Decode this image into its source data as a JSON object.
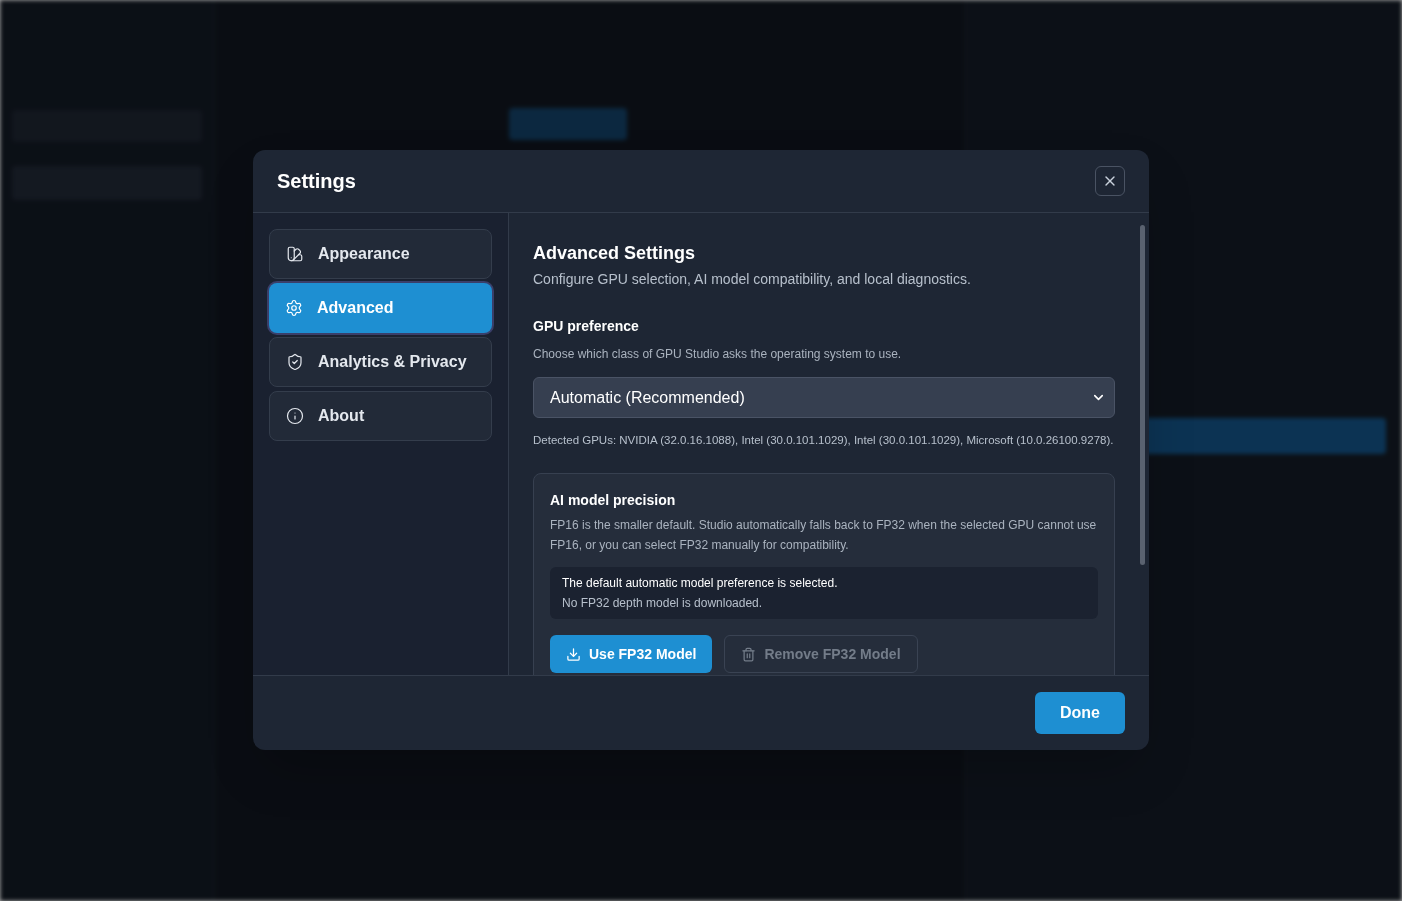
{
  "dialog": {
    "title": "Settings"
  },
  "nav": [
    {
      "label": "Appearance",
      "selected": false
    },
    {
      "label": "Advanced",
      "selected": true
    },
    {
      "label": "Analytics & Privacy",
      "selected": false
    },
    {
      "label": "About",
      "selected": false
    }
  ],
  "section": {
    "title": "Advanced Settings",
    "description": "Configure GPU selection, AI model compatibility, and local diagnostics."
  },
  "gpu": {
    "title": "GPU preference",
    "description": "Choose which class of GPU Studio asks the operating system to use.",
    "value": "Automatic (Recommended)",
    "detected": "Detected GPUs: NVIDIA (32.0.16.1088), Intel (30.0.101.1029), Intel (30.0.101.1029), Microsoft (10.0.26100.9278)."
  },
  "precision": {
    "title": "AI model precision",
    "description": "FP16 is the smaller default. Studio automatically falls back to FP32 when the selected GPU cannot use FP16, or you can select FP32 manually for compatibility.",
    "status": [
      "The default automatic model preference is selected.",
      "No FP32 depth model is downloaded."
    ],
    "buttons": [
      {
        "label": "Use FP32 Model",
        "kind": "primary",
        "disabled": false
      },
      {
        "label": "Remove FP32 Model",
        "kind": "danger",
        "disabled": true
      }
    ]
  },
  "footer": {
    "done": "Done"
  }
}
